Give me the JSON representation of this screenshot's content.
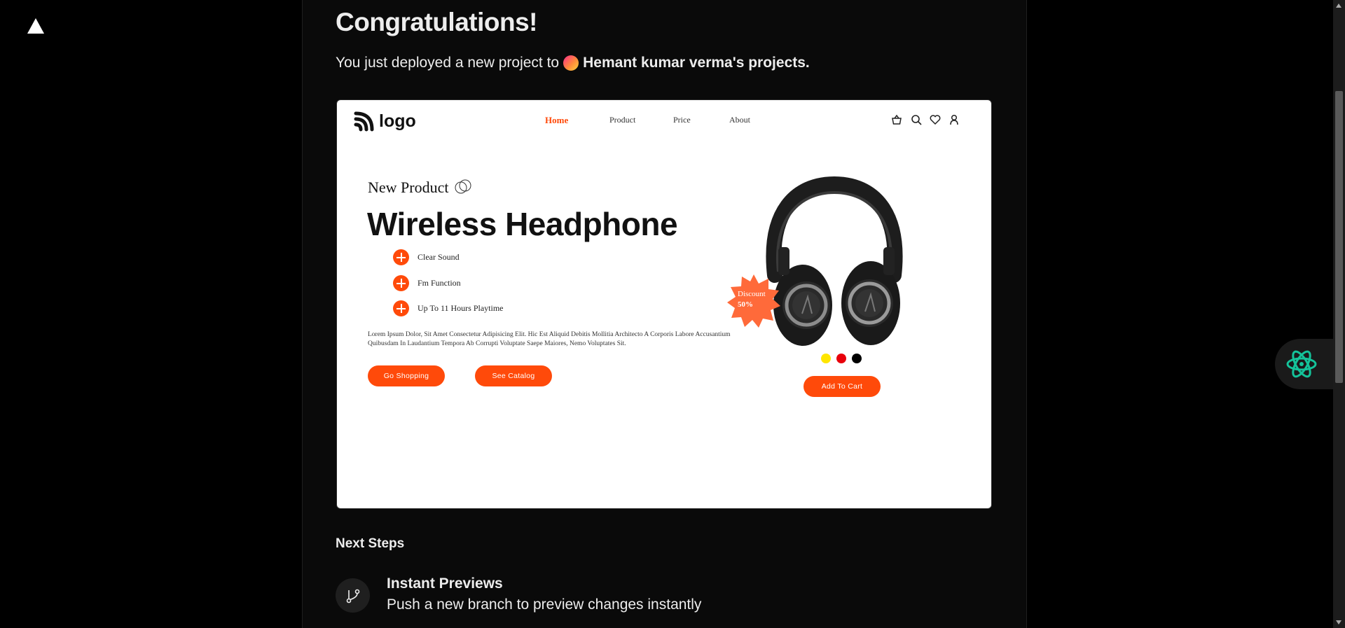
{
  "header": {
    "title": "Congratulations!",
    "deploy_prefix": "You just deployed a new project to",
    "team_name": "Hemant kumar verma's projects."
  },
  "preview": {
    "logo_text": "logo",
    "nav": [
      "Home",
      "Product",
      "Price",
      "About"
    ],
    "nav_icons": [
      "basket-icon",
      "search-icon",
      "heart-icon",
      "user-icon"
    ],
    "new_product": "New Product",
    "headline": "Wireless Headphone",
    "features": [
      "Clear Sound",
      "Fm Function",
      "Up To 11 Hours Playtime"
    ],
    "lorem": "Lorem Ipsum Dolor, Sit Amet Consectetur Adipisicing Elit. Hic Est Aliquid Debitis Mollitia Architecto A Corporis Labore Accusantium Quibusdam In Laudantium Tempora Ab Corrupti Voluptate Saepe Maiores, Nemo Voluptates Sit.",
    "go_shopping": "Go Shopping",
    "see_catalog": "See Catalog",
    "discount_label": "Discount",
    "discount_value": "50%",
    "swatches": [
      "#ffe600",
      "#e8000b",
      "#000000"
    ],
    "add_to_cart": "Add To Cart",
    "accent": "#ff4a0a"
  },
  "next_steps": {
    "heading": "Next Steps",
    "items": [
      {
        "title": "Instant Previews",
        "desc": "Push a new branch to preview changes instantly",
        "icon": "git-branch-icon"
      }
    ]
  }
}
